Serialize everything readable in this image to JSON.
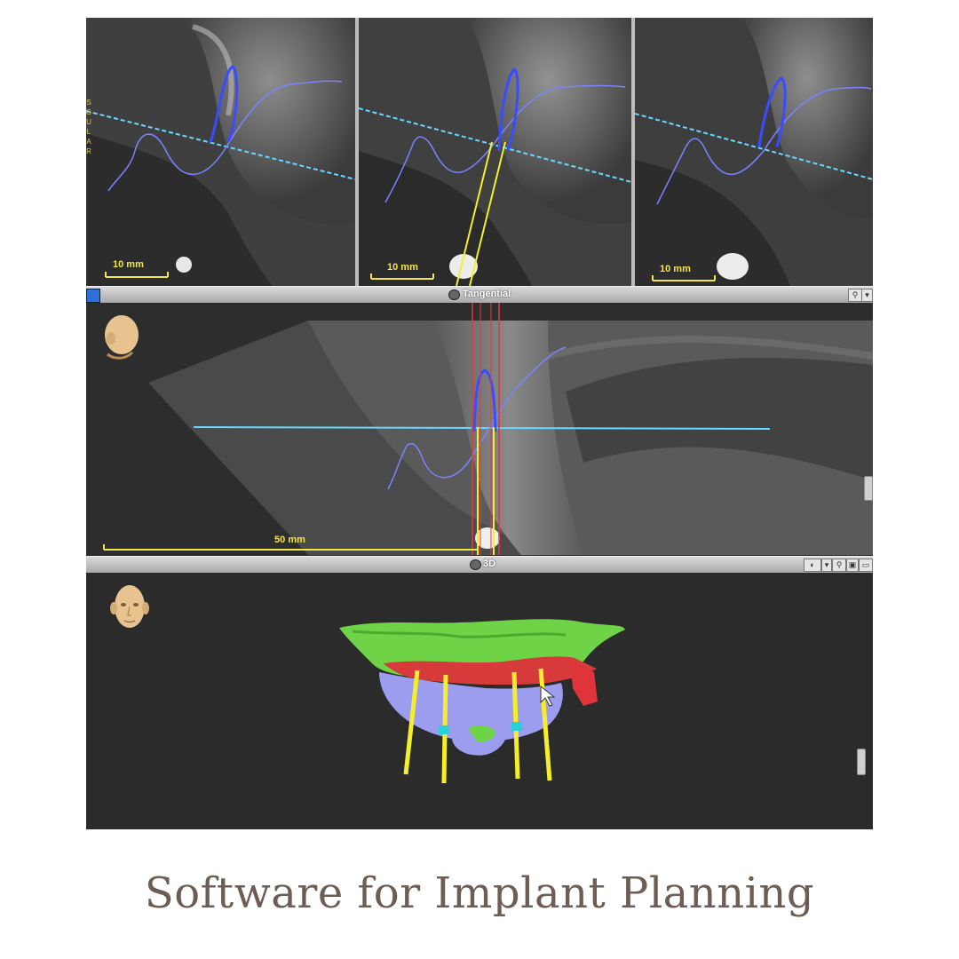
{
  "cross_sections": [
    {
      "scale_label": "10 mm"
    },
    {
      "scale_label": "10 mm"
    },
    {
      "scale_label": "10 mm"
    }
  ],
  "side_label": "S\nG\nU\nL\nA\nR",
  "tangential_panel": {
    "title": "Tangential",
    "scale_label": "50 mm"
  },
  "view3d_panel": {
    "title": "3D"
  },
  "caption": "Software for Implant Planning",
  "colors": {
    "nerve_trace": "#4a5cff",
    "reference_line": "#67d8ff",
    "implant_axis": "#f4ee2b",
    "safety_zone": "#e23b3b",
    "bone_green": "#6fd347",
    "gum_lilac": "#9d9df0",
    "caption": "#6d5d55"
  }
}
